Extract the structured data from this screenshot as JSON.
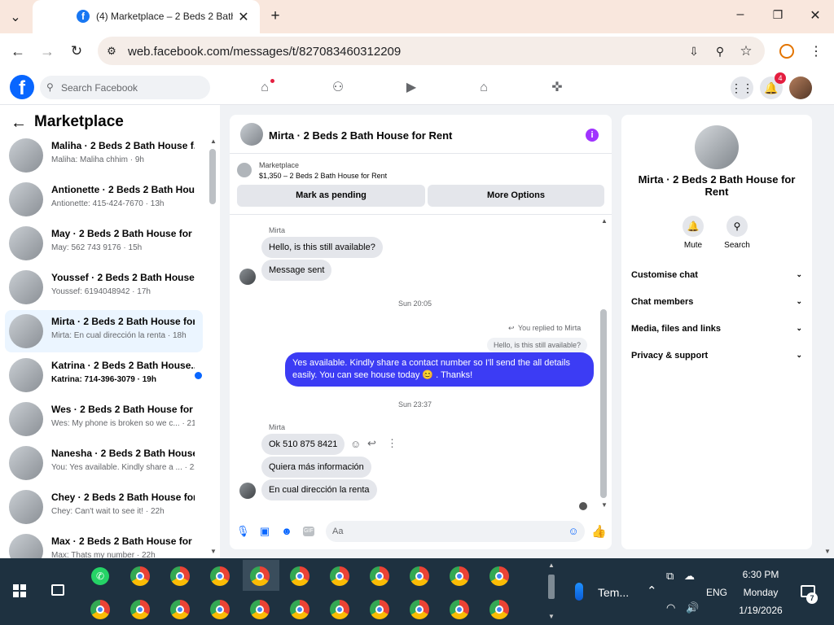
{
  "browser": {
    "tab_title": "(4) Marketplace – 2 Beds 2 Bath",
    "url": "web.facebook.com/messages/t/827083460312209"
  },
  "fb": {
    "search_placeholder": "Search Facebook",
    "notif_count": "4"
  },
  "sidebar": {
    "title": "Marketplace",
    "conversations": [
      {
        "name": "Maliha · 2 Beds 2 Bath House f...",
        "preview": "Maliha: Maliha chhim · 9h"
      },
      {
        "name": "Antionette · 2 Beds 2 Bath Hou...",
        "preview": "Antionette: 415-424-7670 · 13h"
      },
      {
        "name": "May · 2 Beds 2 Bath House for ...",
        "preview": "May: 562 743 9176 · 15h"
      },
      {
        "name": "Youssef · 2 Beds 2 Bath House f...",
        "preview": "Youssef: 6194048942 · 17h"
      },
      {
        "name": "Mirta · 2 Beds 2 Bath House for...",
        "preview": "Mirta: En cual dirección la renta · 18h"
      },
      {
        "name": "Katrina · 2 Beds 2 Bath House...",
        "preview": "Katrina: 714-396-3079 · 19h"
      },
      {
        "name": "Wes · 2 Beds 2 Bath House for ...",
        "preview": "Wes: My phone is broken so we c... · 21h"
      },
      {
        "name": "Nanesha · 2 Beds 2 Bath House ...",
        "preview": "You: Yes available. Kindly share a ... · 22h"
      },
      {
        "name": "Chey · 2 Beds 2 Bath House for ...",
        "preview": "Chey: Can't wait to see it! · 22h"
      },
      {
        "name": "Max · 2 Beds 2 Bath House for ...",
        "preview": "Max: Thats my number · 22h"
      }
    ]
  },
  "chat": {
    "title": "Mirta · 2 Beds 2 Bath House for Rent",
    "marketplace_label": "Marketplace",
    "listing": "$1,350 – 2 Beds 2 Bath House for Rent",
    "btn_pending": "Mark as pending",
    "btn_more": "More Options",
    "sender1": "Mirta",
    "msg1": "Hello, is this still available?",
    "msg2": "Message sent",
    "time1": "Sun 20:05",
    "replied_to": "You replied to Mirta",
    "quoted": "Hello, is this still available?",
    "out_msg": "Yes available. Kindly share a contact number so I'll send the all details easily. You can see house today 😊 . Thanks!",
    "time2": "Sun 23:37",
    "sender2": "Mirta",
    "msg3": "Ok 510 875 8421",
    "msg4": "Quiera más información",
    "msg5": "En cual dirección la renta",
    "input_placeholder": "Aa"
  },
  "info_panel": {
    "title": "Mirta · 2 Beds 2 Bath House for Rent",
    "mute_label": "Mute",
    "search_label": "Search",
    "sections": [
      "Customise chat",
      "Chat members",
      "Media, files and links",
      "Privacy & support"
    ]
  },
  "taskbar": {
    "weather": "Tem...",
    "lang": "ENG",
    "time": "6:30 PM",
    "day": "Monday",
    "date": "1/19/2026",
    "notif_count": "7"
  }
}
